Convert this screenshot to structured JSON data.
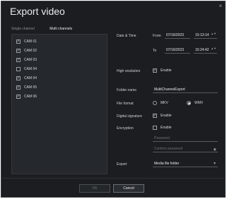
{
  "dialog": {
    "title": "Export video",
    "close_glyph": "×"
  },
  "tabs": [
    {
      "label": "Single channel"
    },
    {
      "label": "Multi channels"
    }
  ],
  "channels": [
    {
      "label": "CAM 01",
      "checked": true
    },
    {
      "label": "CAM 02",
      "checked": true
    },
    {
      "label": "CAM 03",
      "checked": true
    },
    {
      "label": "CAM 04",
      "checked": false
    },
    {
      "label": "CAM 04",
      "checked": true
    },
    {
      "label": "CAM 05",
      "checked": true
    },
    {
      "label": "CAM 06",
      "checked": true
    }
  ],
  "form": {
    "date_time_label": "Date & Time",
    "from_label": "From",
    "from_date": "07/16/2023",
    "from_time": "15:13:14",
    "to_label": "To",
    "to_date": "07/16/2023",
    "to_time": "15:24:42",
    "high_res_label": "High resolution",
    "enable_label": "Enable",
    "folder_label": "Folder name",
    "folder_value": "MultiChannelExport",
    "format_label": "File format",
    "format_mkv": "MKV",
    "format_wmv": "WMV",
    "signature_label": "Digital signature",
    "encryption_label": "Encryption",
    "password_placeholder": "Password",
    "confirm_placeholder": "Confirm password",
    "export_label": "Export",
    "export_value": "Media file folder"
  },
  "buttons": {
    "ok": "OK",
    "cancel": "Cancel"
  },
  "icons": {
    "check": "✓",
    "spin": "▲▼",
    "eye": "◉",
    "dropdown": "▼"
  }
}
